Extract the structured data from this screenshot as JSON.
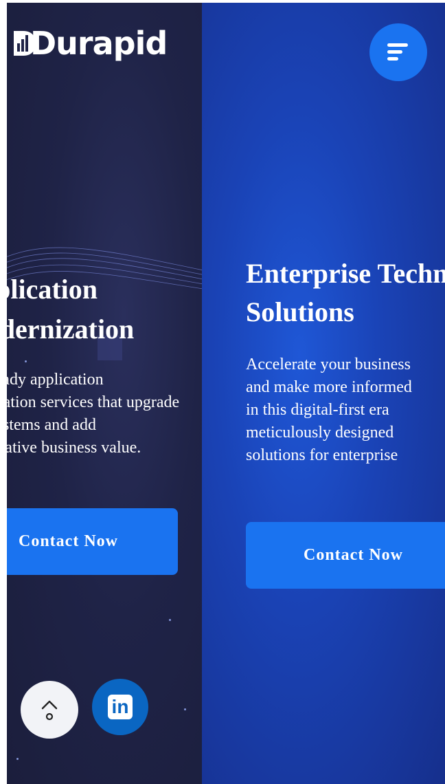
{
  "brand": {
    "name": "Durapid"
  },
  "slides": [
    {
      "heading_lines": [
        "Application",
        "Modernization"
      ],
      "description_lines": [
        "Future-ready application",
        "modernization services that upgrade",
        "legacy systems and add",
        "transformative business value."
      ],
      "cta_label": "Contact Now"
    },
    {
      "heading_lines": [
        "Enterprise Technology",
        "Solutions"
      ],
      "description_lines": [
        "Accelerate your business",
        "and make more informed",
        "in this digital-first era",
        "meticulously designed",
        "solutions for enterprise"
      ],
      "cta_label": "Contact Now"
    }
  ],
  "floating": {
    "scroll_top_icon": "chevron-up-icon",
    "linkedin_label": "in"
  },
  "colors": {
    "accent": "#1a73f0",
    "left_bg": "#1f2347",
    "right_bg": "#1a43b6",
    "linkedin": "#0a66c2"
  }
}
